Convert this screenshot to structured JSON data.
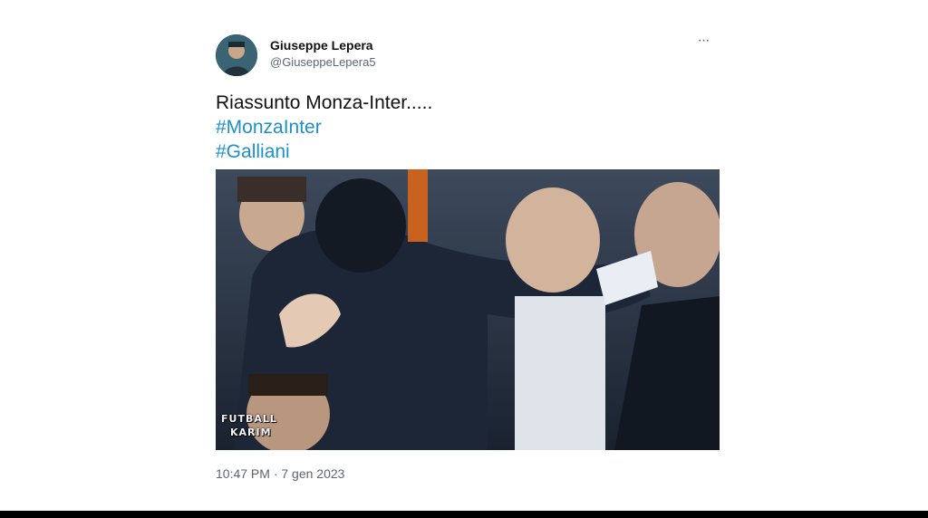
{
  "tweet": {
    "author": {
      "name": "Giuseppe Lepera",
      "handle": "@GiuseppeLepera5"
    },
    "more_label": "···",
    "text": "Riassunto Monza-Inter.....",
    "hashtags": [
      "#MonzaInter",
      "#Galliani"
    ],
    "media": {
      "watermark_line1": "FUTBALL",
      "watermark_line2": "KARIM"
    },
    "timestamp": "10:47 PM · 7 gen 2023"
  },
  "colors": {
    "hashtag": "#1d8fcc",
    "secondary_text": "#5b6670"
  }
}
